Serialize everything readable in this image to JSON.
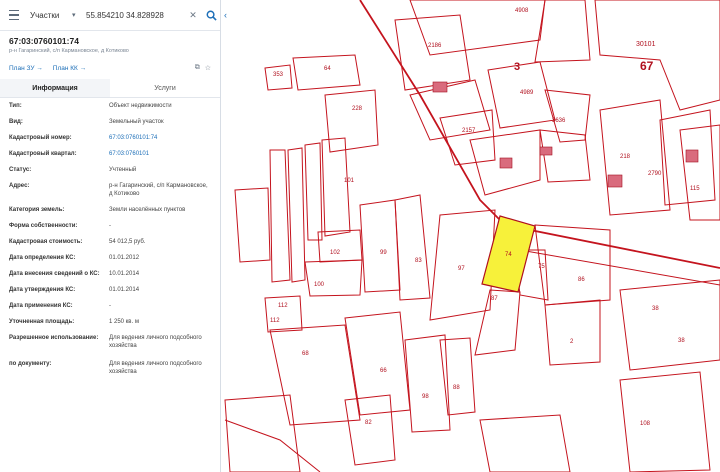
{
  "search": {
    "type": "Участки",
    "query": "55.854210 34.828928"
  },
  "parcel": {
    "title": "67:03:0760101:74",
    "address": "р-н Гагаринский, с/п Кармановское, д Котиково"
  },
  "plans": {
    "zu": "План ЗУ",
    "kk": "План КК"
  },
  "tabs": {
    "info": "Информация",
    "services": "Услуги"
  },
  "rows": [
    {
      "k": "Тип:",
      "v": "Объект недвижимости",
      "l": false
    },
    {
      "k": "Вид:",
      "v": "Земельный участок",
      "l": false
    },
    {
      "k": "Кадастровый номер:",
      "v": "67:03:0760101:74",
      "l": true
    },
    {
      "k": "Кадастровый квартал:",
      "v": "67:03:0760101",
      "l": true
    },
    {
      "k": "Статус:",
      "v": "Учтенный",
      "l": false
    },
    {
      "k": "Адрес:",
      "v": "р-н Гагаринский, с/п Кармановское, д Котиково",
      "l": false
    },
    {
      "k": "Категория земель:",
      "v": "Земли населённых пунктов",
      "l": false
    },
    {
      "k": "Форма собственности:",
      "v": "-",
      "l": false
    },
    {
      "k": "Кадастровая стоимость:",
      "v": "54 012,5 руб.",
      "l": false
    },
    {
      "k": "Дата определения КС:",
      "v": "01.01.2012",
      "l": false
    },
    {
      "k": "Дата внесения сведений о КС:",
      "v": "10.01.2014",
      "l": false
    },
    {
      "k": "Дата утверждения КС:",
      "v": "01.01.2014",
      "l": false
    },
    {
      "k": "Дата применения КС:",
      "v": "-",
      "l": false
    },
    {
      "k": "Уточненная площадь:",
      "v": "1 250 кв. м",
      "l": false
    },
    {
      "k": "Разрешенное использование:",
      "v": "Для ведения личного подсобного хозяйства",
      "l": false
    },
    {
      "k": "по документу:",
      "v": "Для ведения личного подсобного хозяйства",
      "l": false
    }
  ],
  "map_labels": [
    {
      "id": "l4908",
      "t": "4908"
    },
    {
      "id": "l2186",
      "t": "2186"
    },
    {
      "id": "l3",
      "t": "3"
    },
    {
      "id": "l30101",
      "t": "30101"
    },
    {
      "id": "l67",
      "t": "67"
    },
    {
      "id": "l353",
      "t": "353"
    },
    {
      "id": "l64",
      "t": "64"
    },
    {
      "id": "l4989",
      "t": "4989"
    },
    {
      "id": "l228",
      "t": "228"
    },
    {
      "id": "l3636",
      "t": "3636"
    },
    {
      "id": "l2157",
      "t": "2157"
    },
    {
      "id": "l218",
      "t": "218"
    },
    {
      "id": "l2790",
      "t": "2790"
    },
    {
      "id": "l115",
      "t": "115"
    },
    {
      "id": "l101",
      "t": "101"
    },
    {
      "id": "l99",
      "t": "99"
    },
    {
      "id": "l83",
      "t": "83"
    },
    {
      "id": "l97",
      "t": "97"
    },
    {
      "id": "l74",
      "t": "74"
    },
    {
      "id": "l75",
      "t": "75"
    },
    {
      "id": "l86",
      "t": "86"
    },
    {
      "id": "l102",
      "t": "102"
    },
    {
      "id": "l100",
      "t": "100"
    },
    {
      "id": "l87",
      "t": "87"
    },
    {
      "id": "l112a",
      "t": "112"
    },
    {
      "id": "l112b",
      "t": "112"
    },
    {
      "id": "l68",
      "t": "68"
    },
    {
      "id": "l38a",
      "t": "38"
    },
    {
      "id": "l38b",
      "t": "38"
    },
    {
      "id": "l2",
      "t": "2"
    },
    {
      "id": "l66",
      "t": "66"
    },
    {
      "id": "l88",
      "t": "88"
    },
    {
      "id": "l98",
      "t": "98"
    },
    {
      "id": "l108",
      "t": "108"
    },
    {
      "id": "l82",
      "t": "82"
    }
  ]
}
